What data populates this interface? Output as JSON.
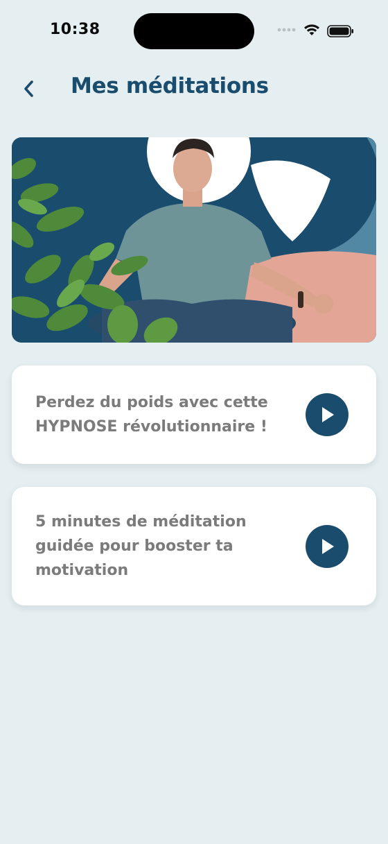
{
  "status_bar": {
    "time": "10:38"
  },
  "header": {
    "back_icon": "chevron-left-icon",
    "title": "Mes méditations"
  },
  "hero": {
    "image": "man-meditating-with-plants-illustration"
  },
  "meditations": [
    {
      "title": "Perdez du poids avec cette HYPNOSE révolutionnaire !",
      "action_icon": "play-icon"
    },
    {
      "title": "5 minutes de méditation guidée pour booster ta motivation",
      "action_icon": "play-icon"
    }
  ],
  "colors": {
    "background": "#e5eef0",
    "brand": "#1a4d6d",
    "card_text": "#7b7b7b",
    "accent_pink": "#e3a595"
  }
}
